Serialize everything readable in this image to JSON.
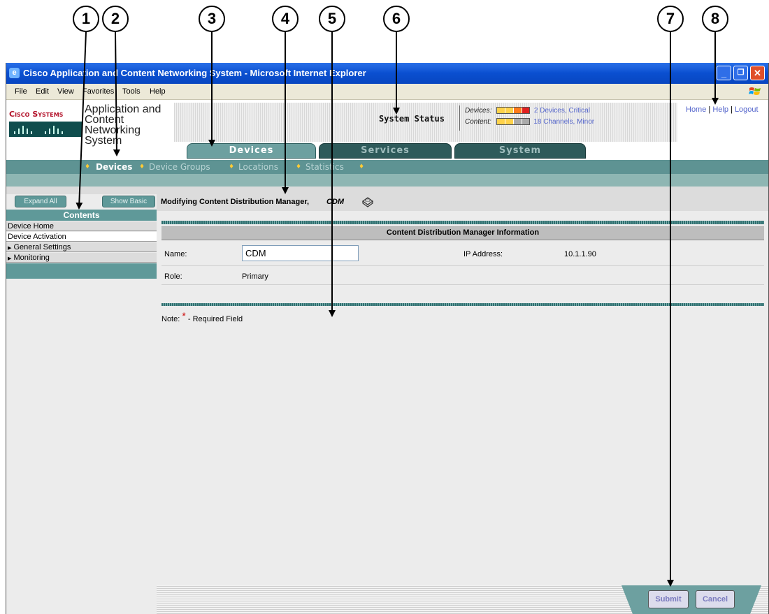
{
  "callouts": [
    "1",
    "2",
    "3",
    "4",
    "5",
    "6",
    "7",
    "8"
  ],
  "window": {
    "title": "Cisco Application and Content Networking System - Microsoft Internet Explorer",
    "controls": {
      "minimize": "_",
      "restore": "❐",
      "close": "✕"
    }
  },
  "menu": [
    "File",
    "Edit",
    "View",
    "Favorites",
    "Tools",
    "Help"
  ],
  "header": {
    "logo_text": "Cisco Systems",
    "product_name_lines": [
      "Application and",
      "Content",
      "Networking",
      "System"
    ],
    "system_status_label": "System Status",
    "devices_label": "Devices:",
    "devices_status": "2 Devices, Critical",
    "content_label": "Content:",
    "content_status": "18 Channels, Minor",
    "links": [
      "Home",
      "Help",
      "Logout"
    ],
    "link_separator": "|"
  },
  "tabs": [
    "Devices",
    "Services",
    "System"
  ],
  "subnav": {
    "items": [
      "Devices",
      "Device Groups",
      "Locations",
      "Statistics"
    ],
    "active": "Devices",
    "bullet": "♦"
  },
  "sidebar": {
    "expand_all": "Expand All",
    "show_basic": "Show Basic",
    "heading": "Contents",
    "items": [
      {
        "label": "Device Home",
        "expandable": false,
        "selected": false
      },
      {
        "label": "Device Activation",
        "expandable": false,
        "selected": true
      },
      {
        "label": "General Settings",
        "expandable": true,
        "selected": false
      },
      {
        "label": "Monitoring",
        "expandable": true,
        "selected": false
      }
    ],
    "expand_glyph": "▶"
  },
  "main": {
    "page_title": "Modifying Content Distribution Manager,",
    "page_title_device": "CDM",
    "section_header": "Content Distribution Manager Information",
    "name_label": "Name:",
    "name_value": "CDM",
    "ip_label": "IP Address:",
    "ip_value": "10.1.1.90",
    "role_label": "Role:",
    "role_value": "Primary",
    "note_prefix": "Note:",
    "note_star": "*",
    "note_text": "- Required Field"
  },
  "footer": {
    "submit": "Submit",
    "cancel": "Cancel"
  },
  "colors": {
    "accent_teal": "#5e9393",
    "tab_active": "#6da0a0",
    "tab_inactive": "#2e5a5a",
    "status_link": "#5566cc",
    "required_star": "#cc0000",
    "ie_blue": "#0a4fd0"
  },
  "icons": [
    "ie-logo-icon",
    "windows-flag-icon",
    "printer-icon",
    "status-light-icon",
    "expand-triangle-icon"
  ]
}
